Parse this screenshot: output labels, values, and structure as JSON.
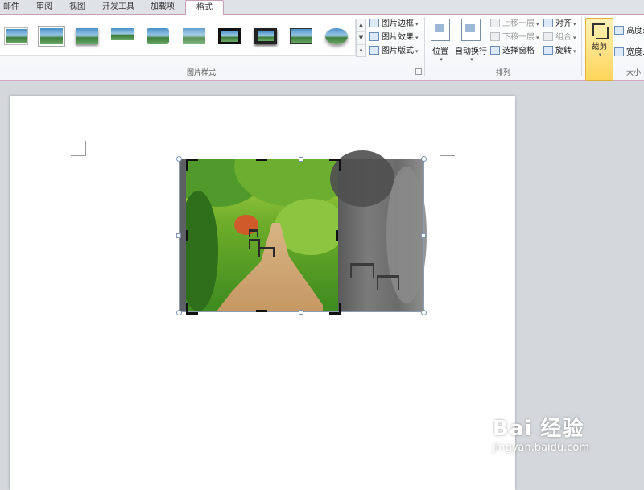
{
  "tabs": [
    {
      "label": "邮件",
      "active": false
    },
    {
      "label": "审阅",
      "active": false
    },
    {
      "label": "视图",
      "active": false
    },
    {
      "label": "开发工具",
      "active": false
    },
    {
      "label": "加载项",
      "active": false
    },
    {
      "label": "格式",
      "active": true
    }
  ],
  "picture_styles": {
    "group_label": "图片样式",
    "gallery_count": 10,
    "buttons": [
      {
        "label": "图片边框",
        "icon": "pen-icon"
      },
      {
        "label": "图片效果",
        "icon": "effects-icon"
      },
      {
        "label": "图片版式",
        "icon": "layout-icon"
      }
    ]
  },
  "arrange": {
    "group_label": "排列",
    "position_label": "位置",
    "wrap_label": "自动换行",
    "bring_forward": "上移一层",
    "send_backward": "下移一层",
    "selection_pane": "选择窗格",
    "align": "对齐",
    "group": "组合",
    "rotate": "旋转"
  },
  "size": {
    "group_label": "大小",
    "crop_label": "裁剪",
    "height_label": "高度:",
    "width_label": "宽度:"
  },
  "watermark": {
    "logo_text": "Bai 经验",
    "url": "jingyan.baidu.com"
  },
  "colors": {
    "accent_pink": "#d7a6c2",
    "crop_active": "#ffd65a"
  }
}
